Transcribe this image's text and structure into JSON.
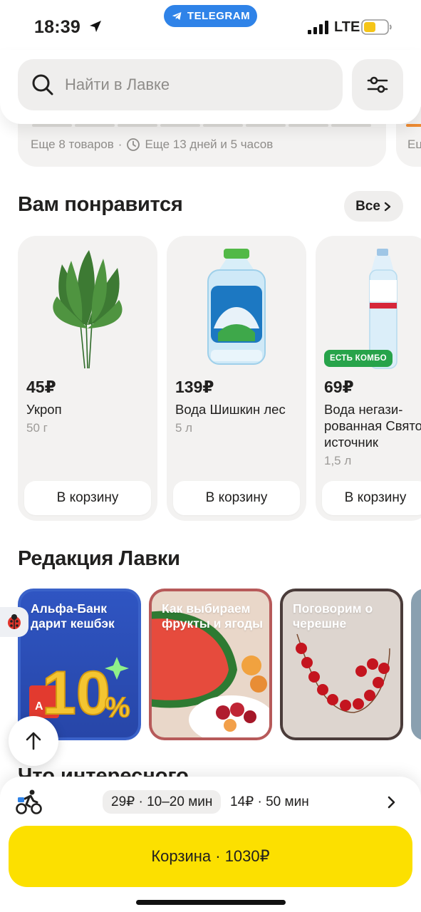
{
  "status_bar": {
    "time": "18:39",
    "network": "LTE",
    "telegram_label": "TELEGRAM"
  },
  "search": {
    "placeholder": "Найти в Лавке"
  },
  "previous_block": {
    "items_more": "Еще 8 товаров",
    "separator": "·",
    "time_left": "Еще 13 дней и 5 часов",
    "next_card_text": "Ец"
  },
  "recommend": {
    "title": "Вам понравится",
    "all_label": "Все",
    "products": [
      {
        "price": "45₽",
        "name": "Укроп",
        "weight": "50 г",
        "cart_label": "В корзину"
      },
      {
        "price": "139₽",
        "name": "Вода Шишкин лес",
        "weight": "5 л",
        "cart_label": "В корзину"
      },
      {
        "price": "69₽",
        "name": "Вода негази-рованная Свято источник",
        "weight": "1,5 л",
        "cart_label": "В корзину",
        "badge": "ЕСТЬ КОМБО"
      }
    ]
  },
  "editorial": {
    "title": "Редакция Лавки",
    "stories": [
      {
        "text": "Альфа-Банк дарит кешбэк"
      },
      {
        "text": "Как выбираем фрукты и ягоды"
      },
      {
        "text": "Поговорим о черешне"
      }
    ]
  },
  "next_section_title": "Что интересного",
  "delivery": {
    "option_selected": "29₽ · 10–20 мин",
    "option_alt": "14₽ · 50 мин"
  },
  "cart": {
    "label": "Корзина · 1030₽"
  },
  "colors": {
    "accent_yellow": "#fce000",
    "telegram_blue": "#2f83e8",
    "combo_green": "#27a34a",
    "card_bg": "#f3f2f1"
  }
}
